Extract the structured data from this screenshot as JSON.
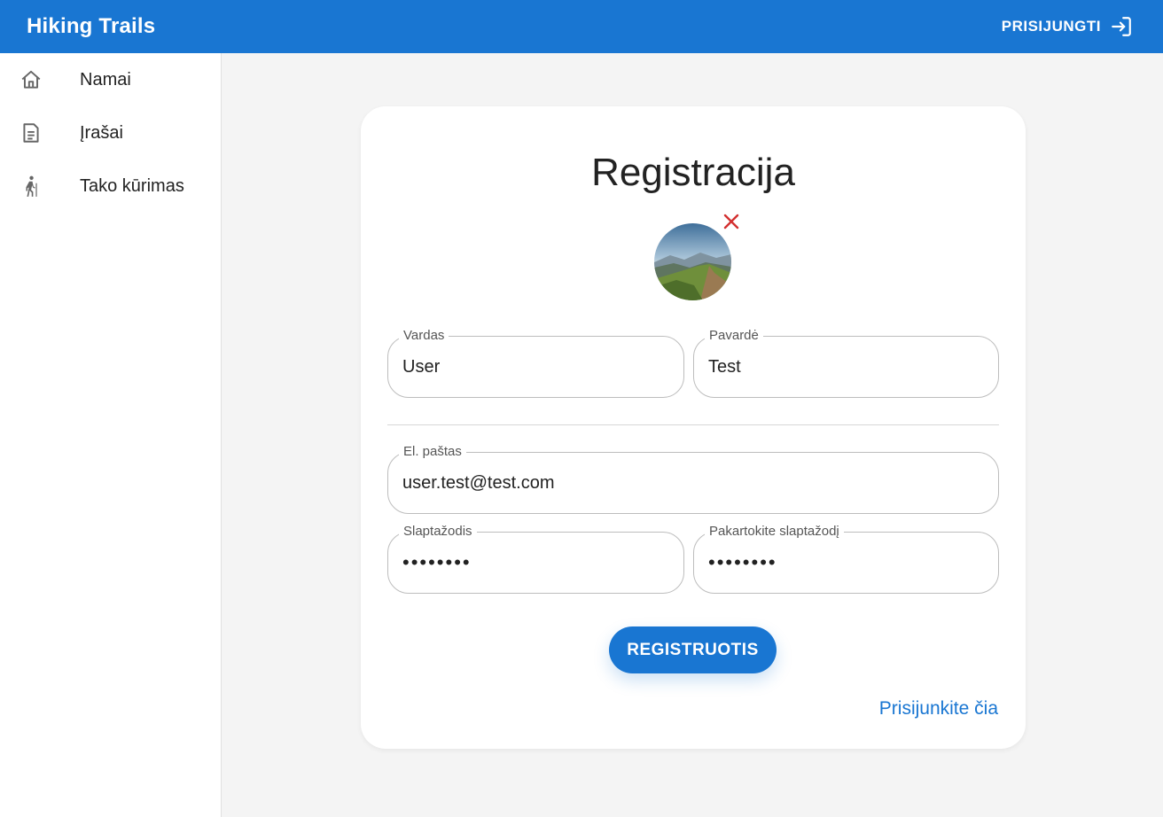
{
  "appbar": {
    "title": "Hiking Trails",
    "login_label": "PRISIJUNGTI"
  },
  "sidebar": {
    "items": [
      {
        "label": "Namai",
        "icon": "home-icon"
      },
      {
        "label": "Įrašai",
        "icon": "document-icon"
      },
      {
        "label": "Tako kūrimas",
        "icon": "hiker-icon"
      }
    ]
  },
  "form": {
    "title": "Registracija",
    "first_name": {
      "label": "Vardas",
      "value": "User"
    },
    "last_name": {
      "label": "Pavardė",
      "value": "Test"
    },
    "email": {
      "label": "El. paštas",
      "value": "user.test@test.com"
    },
    "password": {
      "label": "Slaptažodis",
      "value": "••••••••"
    },
    "repeat_password": {
      "label": "Pakartokite slaptažodį",
      "value": "••••••••"
    },
    "submit_label": "REGISTRUOTIS",
    "login_link": "Prisijunkite čia"
  },
  "colors": {
    "primary": "#1976d2",
    "remove_icon": "#d32f2f",
    "page_background": "#f4f4f4"
  }
}
